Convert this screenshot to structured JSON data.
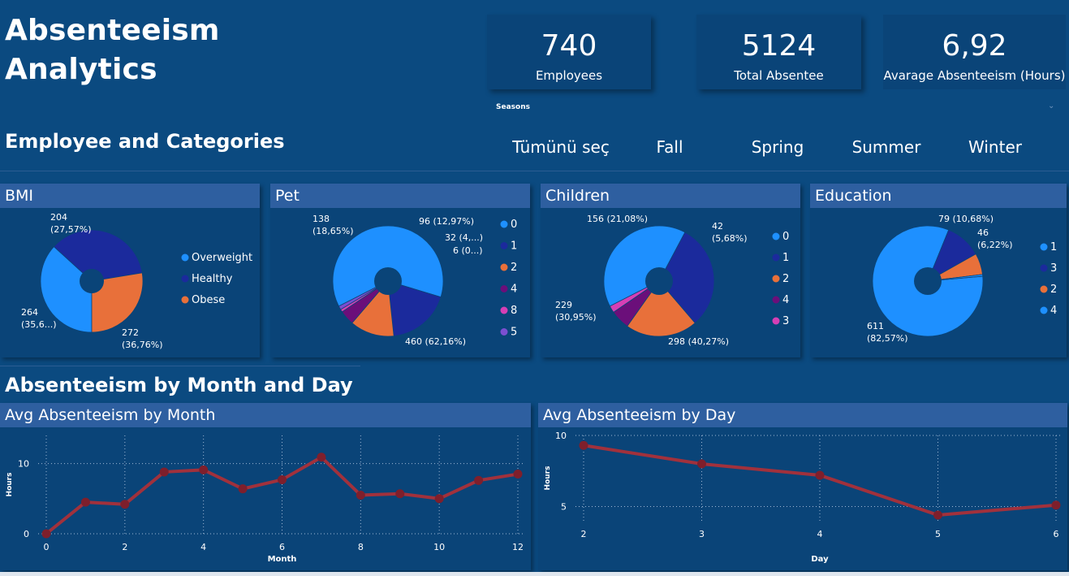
{
  "header": {
    "title_line1": "Absenteeism",
    "title_line2": "Analytics"
  },
  "kpis": [
    {
      "value": "740",
      "label": "Employees"
    },
    {
      "value": "5124",
      "label": "Total Absentee"
    },
    {
      "value": "6,92",
      "label": "Avarage Absenteeism (Hours)"
    }
  ],
  "slicer": {
    "title": "Seasons",
    "options": [
      "Tümünü seç",
      "Fall",
      "Spring",
      "Summer",
      "Winter"
    ]
  },
  "sections": {
    "categories": "Employee and Categories",
    "month_day": "Absenteeism by Month and Day"
  },
  "colors": {
    "background": "#0b4a80",
    "panel": "#0a4478",
    "panel_header": "#2e5fa0",
    "light_blue": "#1e90ff",
    "dark_blue": "#1b2a9c",
    "orange": "#e8703a",
    "purple": "#6b0f7a",
    "pink": "#d63fb5",
    "violet": "#7b4fd1",
    "line": "#a1313c"
  },
  "pies": [
    {
      "title": "BMI",
      "slices": [
        {
          "label": "Overweight",
          "value": 272,
          "text": "272\n(36,76%)",
          "color": "#1e90ff"
        },
        {
          "label": "Healthy",
          "value": 264,
          "text": "264\n(35,6...)",
          "color": "#1b2a9c"
        },
        {
          "label": "Obese",
          "value": 204,
          "text": "204\n(27,57%)",
          "color": "#e8703a"
        }
      ],
      "legend": [
        "Overweight",
        "Healthy",
        "Obese"
      ],
      "legend_colors": [
        "#1e90ff",
        "#1b2a9c",
        "#e8703a"
      ]
    },
    {
      "title": "Pet",
      "slices": [
        {
          "label": "0",
          "value": 460,
          "text": "460 (62,16%)",
          "color": "#1e90ff"
        },
        {
          "label": "1",
          "value": 138,
          "text": "138\n(18,65%)",
          "color": "#1b2a9c"
        },
        {
          "label": "2",
          "value": 96,
          "text": "96 (12,97%)",
          "color": "#e8703a"
        },
        {
          "label": "4",
          "value": 32,
          "text": "32 (4,...)",
          "color": "#6b0f7a"
        },
        {
          "label": "8",
          "value": 6,
          "text": "6 (0...)",
          "color": "#d63fb5"
        },
        {
          "label": "5",
          "value": 8,
          "text": "",
          "color": "#7b4fd1"
        }
      ],
      "legend": [
        "0",
        "1",
        "2",
        "4",
        "8",
        "5"
      ],
      "legend_colors": [
        "#1e90ff",
        "#1b2a9c",
        "#e8703a",
        "#6b0f7a",
        "#d63fb5",
        "#7b4fd1"
      ]
    },
    {
      "title": "Children",
      "slices": [
        {
          "label": "0",
          "value": 298,
          "text": "298 (40,27%)",
          "color": "#1e90ff"
        },
        {
          "label": "1",
          "value": 229,
          "text": "229\n(30,95%)",
          "color": "#1b2a9c"
        },
        {
          "label": "2",
          "value": 156,
          "text": "156 (21,08%)",
          "color": "#e8703a"
        },
        {
          "label": "4",
          "value": 42,
          "text": "42\n(5,68%)",
          "color": "#6b0f7a"
        },
        {
          "label": "3",
          "value": 15,
          "text": "",
          "color": "#d63fb5"
        }
      ],
      "legend": [
        "0",
        "1",
        "2",
        "4",
        "3"
      ],
      "legend_colors": [
        "#1e90ff",
        "#1b2a9c",
        "#e8703a",
        "#6b0f7a",
        "#d63fb5"
      ]
    },
    {
      "title": "Education",
      "slices": [
        {
          "label": "1",
          "value": 611,
          "text": "611\n(82,57%)",
          "color": "#1e90ff"
        },
        {
          "label": "3",
          "value": 79,
          "text": "79 (10,68%)",
          "color": "#1b2a9c"
        },
        {
          "label": "2",
          "value": 46,
          "text": "46\n(6,22%)",
          "color": "#e8703a"
        },
        {
          "label": "4",
          "value": 4,
          "text": "",
          "color": "#1e90ff"
        }
      ],
      "legend": [
        "1",
        "3",
        "2",
        "4"
      ],
      "legend_colors": [
        "#1e90ff",
        "#1b2a9c",
        "#e8703a",
        "#1e90ff"
      ]
    }
  ],
  "chart_data": [
    {
      "type": "line",
      "title": "Avg Absenteeism by Month",
      "xlabel": "Month",
      "ylabel": "Hours",
      "x": [
        0,
        1,
        2,
        3,
        4,
        5,
        6,
        7,
        8,
        9,
        10,
        11,
        12
      ],
      "y": [
        0,
        4.5,
        4.2,
        8.8,
        9.1,
        6.4,
        7.7,
        10.9,
        5.5,
        5.7,
        5.0,
        7.6,
        8.5
      ],
      "xticks": [
        "0",
        "2",
        "4",
        "6",
        "8",
        "10",
        "12"
      ],
      "yticks": [
        "0",
        "10"
      ],
      "xlim": [
        0,
        12
      ],
      "ylim": [
        0,
        14
      ],
      "grid": true
    },
    {
      "type": "line",
      "title": "Avg Absenteeism by Day",
      "xlabel": "Day",
      "ylabel": "Hours",
      "x": [
        2,
        3,
        4,
        5,
        6
      ],
      "y": [
        9.3,
        8.0,
        7.2,
        4.4,
        5.1
      ],
      "xticks": [
        "2",
        "3",
        "4",
        "5",
        "6"
      ],
      "yticks": [
        "5",
        "10"
      ],
      "xlim": [
        2,
        6
      ],
      "ylim": [
        4,
        10
      ],
      "grid": true
    }
  ]
}
